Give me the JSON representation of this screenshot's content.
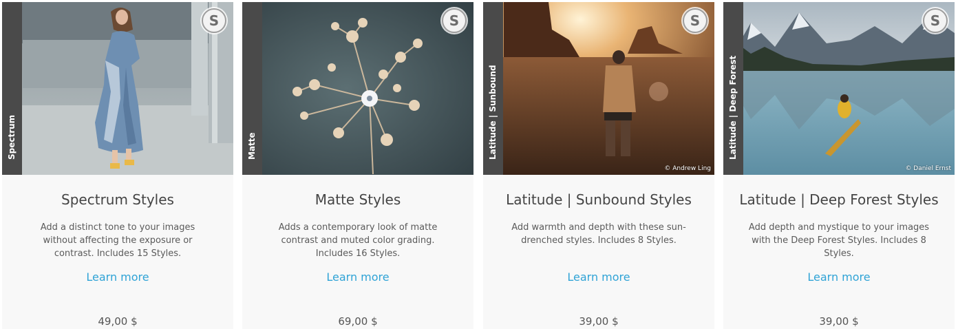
{
  "products": [
    {
      "side_label": "Spectrum",
      "badge_letter": "S",
      "title": "Spectrum Styles",
      "description": "Add a distinct tone to your images without affecting the exposure or contrast. Includes 15 Styles.",
      "learn_more": "Learn more",
      "price": "49,00 $",
      "photo_credit": ""
    },
    {
      "side_label": "Matte",
      "badge_letter": "S",
      "title": "Matte Styles",
      "description": "Adds a contemporary look of matte contrast and muted color grading. Includes 16 Styles.",
      "learn_more": "Learn more",
      "price": "69,00 $",
      "photo_credit": ""
    },
    {
      "side_label": "Latitude | Sunbound",
      "badge_letter": "S",
      "title": "Latitude | Sunbound Styles",
      "description": "Add warmth and depth with these sun-drenched styles. Includes 8 Styles.",
      "learn_more": "Learn more",
      "price": "39,00 $",
      "photo_credit": "© Andrew Ling"
    },
    {
      "side_label": "Latitude | Deep Forest",
      "badge_letter": "S",
      "title": "Latitude | Deep Forest Styles",
      "description": "Add depth and mystique to your images with the Deep Forest Styles. Includes 8 Styles.",
      "learn_more": "Learn more",
      "price": "39,00 $",
      "photo_credit": "© Daniel Ernst"
    }
  ],
  "colors": {
    "link": "#2fa3d6",
    "side_tab": "#4a4a4a",
    "card_bg": "#f8f8f8"
  }
}
